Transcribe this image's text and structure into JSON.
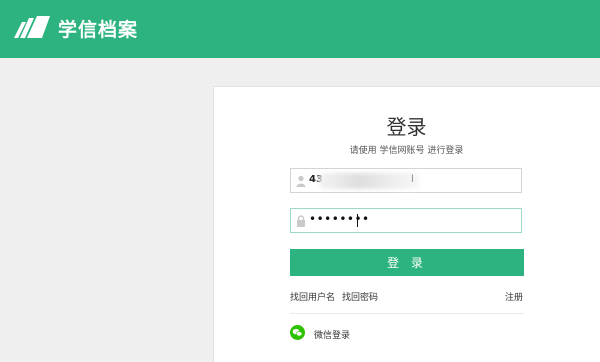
{
  "header": {
    "logo_icon": "book-logo-icon",
    "logo_text": "学信档案"
  },
  "login": {
    "title": "登录",
    "subtitle": "请使用 学信网账号 进行登录",
    "username_prefix": "43",
    "username_suffix": "l",
    "password_masked": "••••••••",
    "submit_label": "登 录",
    "find_username": "找回用户名",
    "find_password": "找回密码",
    "register": "注册",
    "wechat_login": "微信登录"
  },
  "colors": {
    "brand": "#2cb37f",
    "wechat": "#2dc100"
  }
}
